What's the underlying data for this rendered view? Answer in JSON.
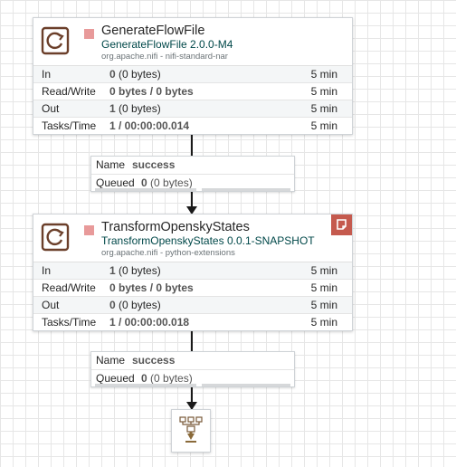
{
  "processors": [
    {
      "name": "GenerateFlowFile",
      "type": "GenerateFlowFile 2.0.0-M4",
      "bundle": "org.apache.nifi - nifi-standard-nar",
      "stats": [
        {
          "label": "In",
          "value_bold": "0",
          "value_rest": " (0 bytes)",
          "time": "5 min"
        },
        {
          "label": "Read/Write",
          "value_bold": "0 bytes / 0 bytes",
          "value_rest": "",
          "time": "5 min"
        },
        {
          "label": "Out",
          "value_bold": "1",
          "value_rest": " (0 bytes)",
          "time": "5 min"
        },
        {
          "label": "Tasks/Time",
          "value_bold": "1 / 00:00:00.014",
          "value_rest": "",
          "time": "5 min"
        }
      ]
    },
    {
      "name": "TransformOpenskyStates",
      "type": "TransformOpenskyStates 0.0.1-SNAPSHOT",
      "bundle": "org.apache.nifi - python-extensions",
      "stats": [
        {
          "label": "In",
          "value_bold": "1",
          "value_rest": " (0 bytes)",
          "time": "5 min"
        },
        {
          "label": "Read/Write",
          "value_bold": "0 bytes / 0 bytes",
          "value_rest": "",
          "time": "5 min"
        },
        {
          "label": "Out",
          "value_bold": "0",
          "value_rest": " (0 bytes)",
          "time": "5 min"
        },
        {
          "label": "Tasks/Time",
          "value_bold": "1 / 00:00:00.018",
          "value_rest": "",
          "time": "5 min"
        }
      ]
    }
  ],
  "connections": [
    {
      "name_label": "Name",
      "name": "success",
      "queued_label": "Queued",
      "queued_count": "0",
      "queued_size": " (0 bytes)"
    },
    {
      "name_label": "Name",
      "name": "success",
      "queued_label": "Queued",
      "queued_count": "0",
      "queued_size": " (0 bytes)"
    }
  ],
  "colors": {
    "run_status": "#e89a9a",
    "comment_badge": "#c55a4e",
    "canvas_grid": "#e6e6e6"
  },
  "icons": [
    "processor-icon",
    "stopped-status-icon",
    "comment-icon",
    "funnel-icon"
  ]
}
